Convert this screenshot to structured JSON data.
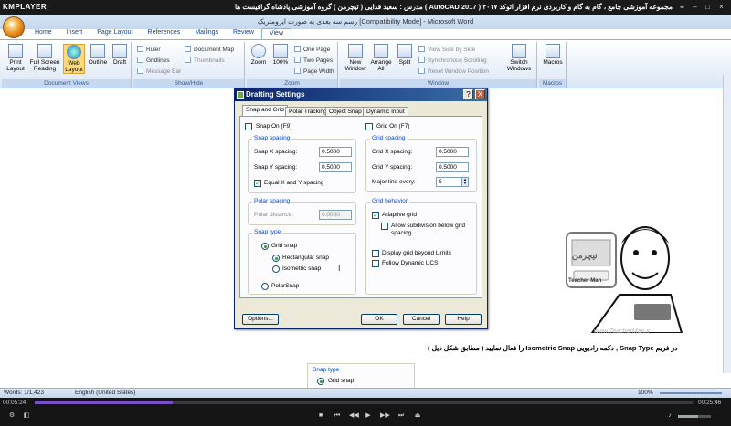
{
  "player": {
    "logo": "KMPLAYER",
    "title": "مجموعه آموزشی جامع ، گام به گام و کاربردی نرم افزار اتوکد ۲۰۱۷ ( AutoCAD 2017 ) مدرس : سعید قدایی ( تیچرمن ) گروه آموزشی پادشاه گرافیست ها",
    "time_elapsed": "00:05:24",
    "time_total": "00:25:46",
    "progress_fraction": 0.21,
    "volume_fraction": 0.6
  },
  "word": {
    "title": "رسم سه بعدی به صورت ایزومتریک [Compatibility Mode] - Microsoft Word",
    "tabs": [
      "Home",
      "Insert",
      "Page Layout",
      "References",
      "Mailings",
      "Review",
      "View"
    ],
    "active_tab": "View",
    "groups": {
      "document_views": "Document Views",
      "show_hide": "Show/Hide",
      "zoom": "Zoom",
      "window": "Window",
      "macros": "Macros"
    },
    "doc_views": [
      "Print Layout",
      "Full Screen Reading",
      "Web Layout",
      "Outline",
      "Draft"
    ],
    "show_hide": [
      "Ruler",
      "Gridlines",
      "Message Bar",
      "Document Map",
      "Thumbnails"
    ],
    "zoom": [
      "Zoom",
      "100%",
      "One Page",
      "Two Pages",
      "Page Width"
    ],
    "window": [
      "New Window",
      "Arrange All",
      "Split",
      "View Side by Side",
      "Synchronous Scrolling",
      "Reset Window Position",
      "Switch Windows"
    ],
    "macros": "Macros",
    "status": {
      "words": "Words: 1/1,423",
      "language": "English (United States)",
      "zoom": "100%"
    },
    "caption": "در فریم Snap Type , دکمه رادیویی Isometric Snap را فعال نمایید ( مطابق شکل ذیل )",
    "snapbox": {
      "title": "Snap type",
      "grid_snap": "Grid snap"
    },
    "watermark": "www.TeacherMan.ir"
  },
  "dialog": {
    "title": "Drafting Settings",
    "tabs": [
      "Snap and Grid",
      "Polar Tracking",
      "Object Snap",
      "Dynamic Input"
    ],
    "snap_on": "Snap On (F9)",
    "grid_on": "Grid On (F7)",
    "snap_spacing": {
      "title": "Snap spacing",
      "x_label": "Snap X spacing:",
      "x_value": "0.5000",
      "y_label": "Snap Y spacing:",
      "y_value": "0.5000",
      "equal": "Equal X and Y spacing"
    },
    "grid_spacing": {
      "title": "Grid spacing",
      "x_label": "Grid X spacing:",
      "x_value": "0.5000",
      "y_label": "Grid Y spacing:",
      "y_value": "0.5000",
      "major_label": "Major line every:",
      "major_value": "5"
    },
    "polar": {
      "title": "Polar spacing",
      "label": "Polar distance:",
      "value": "0.0000"
    },
    "grid_behavior": {
      "title": "Grid behavior",
      "adaptive": "Adaptive grid",
      "subdiv": "Allow subdivision below grid spacing",
      "beyond": "Display grid beyond Limits",
      "dynamic": "Follow Dynamic UCS"
    },
    "snap_type": {
      "title": "Snap type",
      "grid": "Grid snap",
      "rect": "Rectangular snap",
      "iso": "Isometric snap",
      "polar": "PolarSnap"
    },
    "buttons": {
      "options": "Options...",
      "ok": "OK",
      "cancel": "Cancel",
      "help": "Help"
    },
    "help_glyph": "?",
    "close_glyph": "X"
  },
  "mascot": {
    "logo_text": "تیچرمن",
    "sub_text": "Teacher Man"
  }
}
